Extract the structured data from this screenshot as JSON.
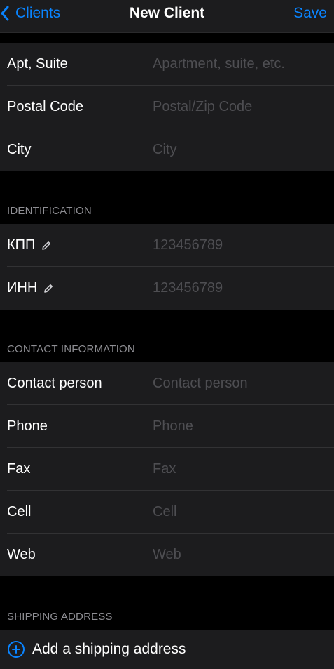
{
  "nav": {
    "back_label": "Clients",
    "title": "New Client",
    "save_label": "Save"
  },
  "address": {
    "rows": [
      {
        "label": "Apt, Suite",
        "placeholder": "Apartment, suite, etc.",
        "value": ""
      },
      {
        "label": "Postal Code",
        "placeholder": "Postal/Zip Code",
        "value": ""
      },
      {
        "label": "City",
        "placeholder": "City",
        "value": ""
      }
    ]
  },
  "identification": {
    "header": "IDENTIFICATION",
    "rows": [
      {
        "label": "КПП",
        "placeholder": "123456789",
        "value": "",
        "icon": "pencil-icon"
      },
      {
        "label": "ИНН",
        "placeholder": "123456789",
        "value": "",
        "icon": "pencil-icon"
      }
    ]
  },
  "contact": {
    "header": "CONTACT INFORMATION",
    "rows": [
      {
        "label": "Contact person",
        "placeholder": "Contact person",
        "value": ""
      },
      {
        "label": "Phone",
        "placeholder": "Phone",
        "value": ""
      },
      {
        "label": "Fax",
        "placeholder": "Fax",
        "value": ""
      },
      {
        "label": "Cell",
        "placeholder": "Cell",
        "value": ""
      },
      {
        "label": "Web",
        "placeholder": "Web",
        "value": ""
      }
    ]
  },
  "shipping": {
    "header": "SHIPPING ADDRESS",
    "add_label": "Add a shipping address",
    "icon": "plus-circle-icon"
  },
  "colors": {
    "accent": "#0a84ff",
    "background": "#000000",
    "cell": "#1c1c1e",
    "placeholder": "#4e4e52",
    "section_header": "#8e8e93"
  }
}
